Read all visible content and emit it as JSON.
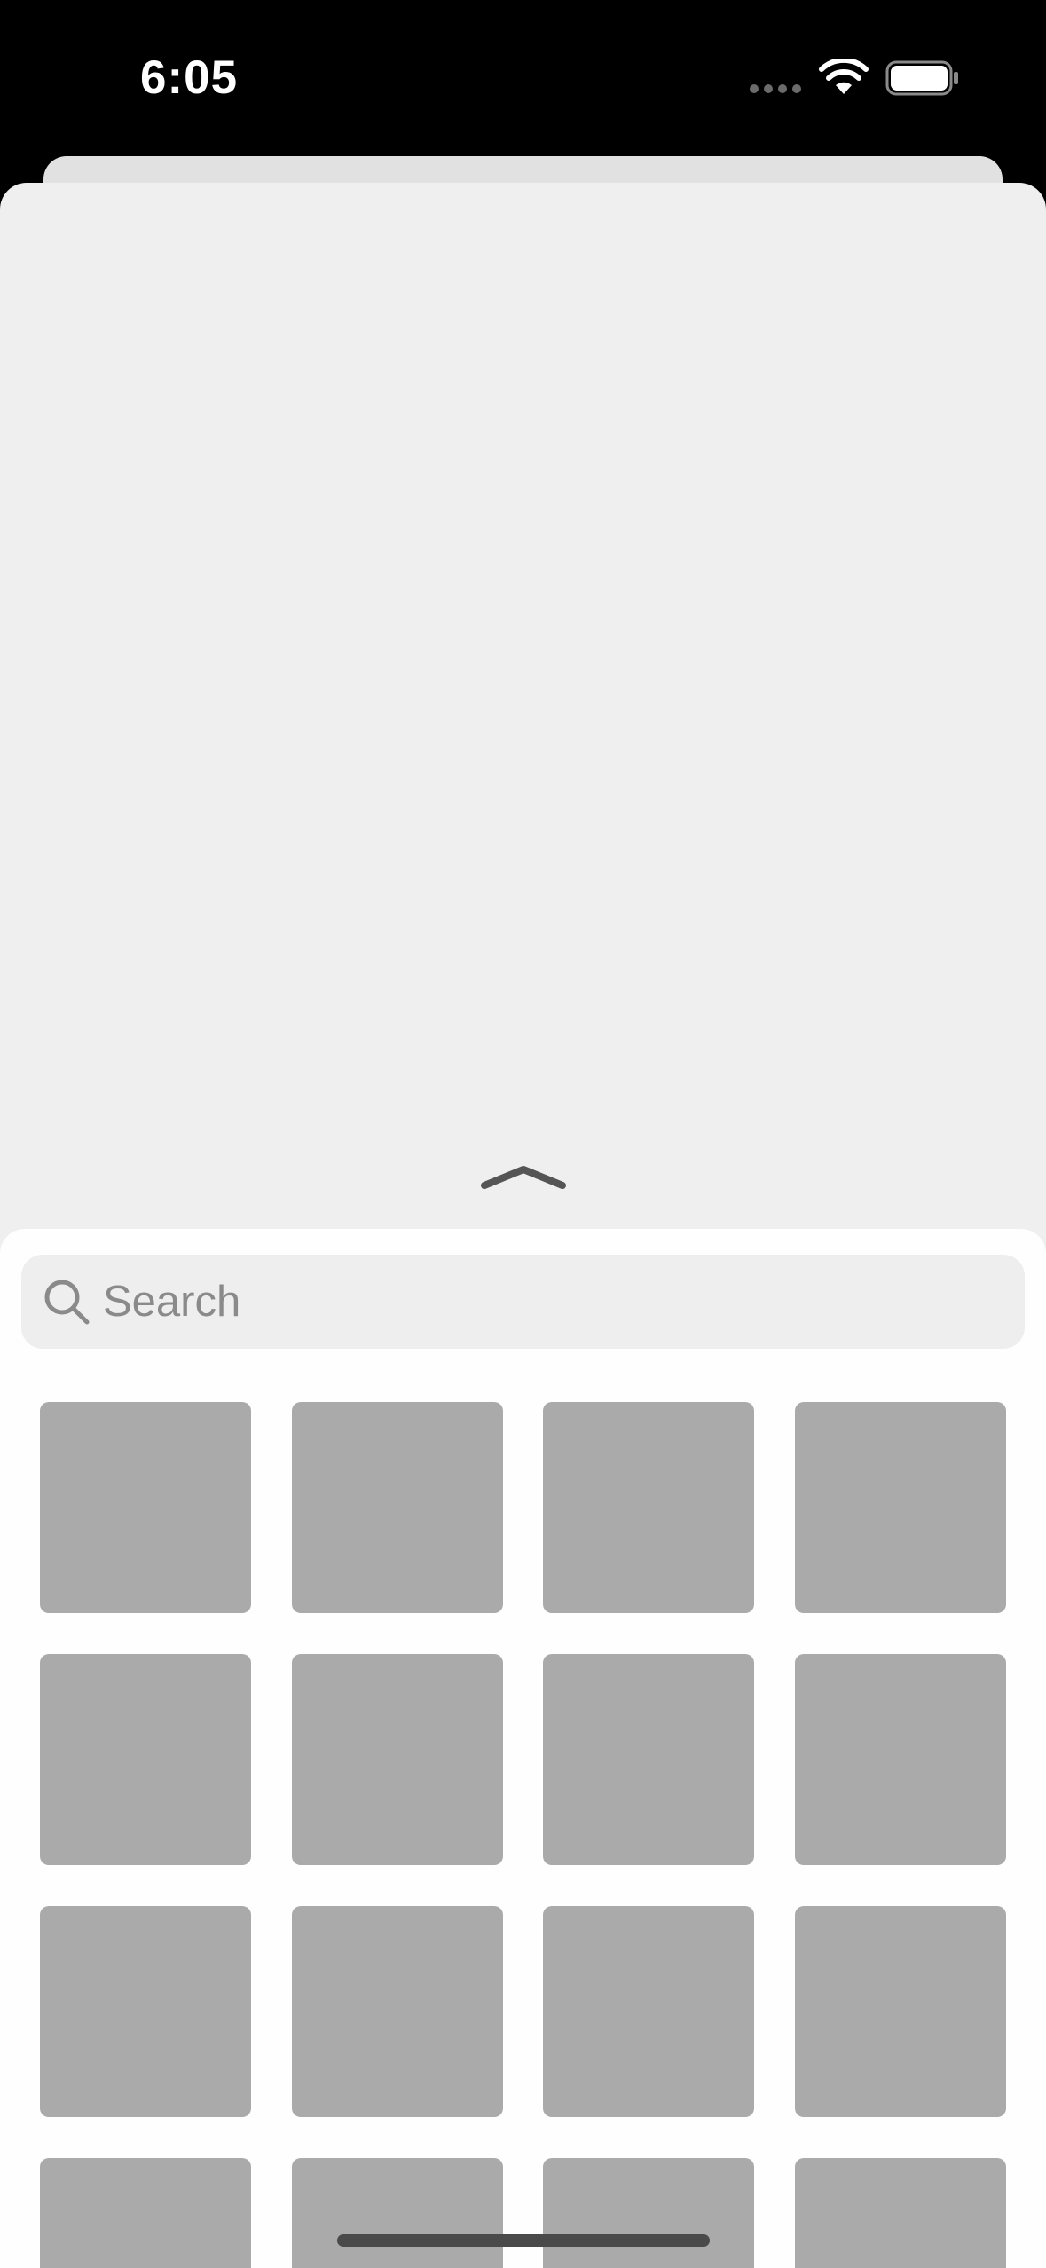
{
  "status_bar": {
    "time": "6:05",
    "icons": [
      "cellular-signal-icon",
      "wifi-icon",
      "battery-icon"
    ]
  },
  "handle": {
    "icon": "chevron-up-icon"
  },
  "search": {
    "placeholder": "Search",
    "value": "",
    "icon": "search-icon"
  },
  "grid": {
    "columns": 4,
    "tiles": [
      {
        "id": 1
      },
      {
        "id": 2
      },
      {
        "id": 3
      },
      {
        "id": 4
      },
      {
        "id": 5
      },
      {
        "id": 6
      },
      {
        "id": 7
      },
      {
        "id": 8
      },
      {
        "id": 9
      },
      {
        "id": 10
      },
      {
        "id": 11
      },
      {
        "id": 12
      },
      {
        "id": 13
      },
      {
        "id": 14
      },
      {
        "id": 15
      },
      {
        "id": 16
      }
    ]
  },
  "colors": {
    "background": "#000000",
    "card": "#efefef",
    "back_card": "#e1e1e1",
    "sheet": "#fefefe",
    "search_field": "#eeeeee",
    "placeholder_text": "#8a8a8a",
    "tile": "#aaaaaa",
    "chevron": "#555555",
    "home_indicator": "#4a4a4a"
  }
}
